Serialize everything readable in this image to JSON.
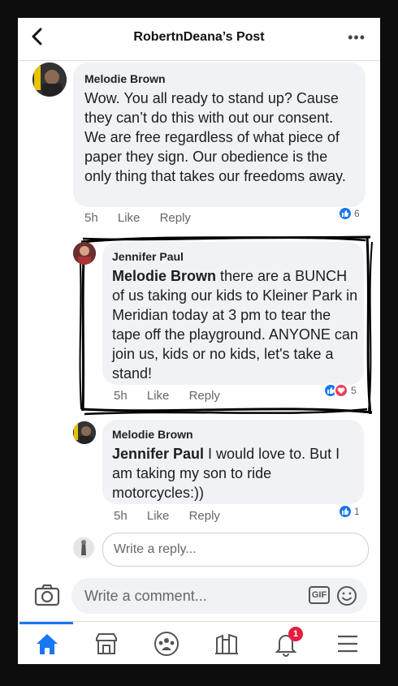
{
  "header": {
    "title": "RobertnDeana’s Post",
    "back_icon": "back-chevron-icon",
    "more_icon": "more-dots-icon"
  },
  "comments": [
    {
      "author": "Melodie Brown",
      "text": "Wow. You all ready to stand up? Cause they can’t do this with out our consent. We are free regardless of what piece of paper they sign. Our obedience is the only thing that takes our freedoms away.",
      "time": "5h",
      "like_label": "Like",
      "reply_label": "Reply",
      "reaction_count": "6"
    },
    {
      "author": "Jennifer Paul",
      "mention": "Melodie Brown",
      "text": " there are a BUNCH of us taking our kids to Kleiner Park in Meridian today at 3 pm to tear the tape off the playground. ANYONE can join us, kids or no kids, let's take a stand!",
      "time": "5h",
      "like_label": "Like",
      "reply_label": "Reply",
      "reaction_count": "5"
    },
    {
      "author": "Melodie Brown",
      "mention": "Jennifer Paul",
      "text": " I would love to. But I am taking my son to ride motorcycles:))",
      "time": "5h",
      "like_label": "Like",
      "reply_label": "Reply",
      "reaction_count": "1"
    }
  ],
  "reply_input": {
    "placeholder": "Write a reply..."
  },
  "comment_input": {
    "placeholder": "Write a comment...",
    "gif_label": "GIF"
  },
  "nav": {
    "notifications_badge": "1",
    "active_color": "#1877f2"
  },
  "colors": {
    "like_blue": "#1877f2",
    "love_red": "#f33e58",
    "bubble": "#f0f2f5"
  }
}
